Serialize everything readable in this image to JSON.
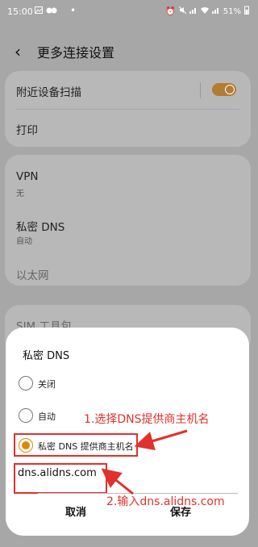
{
  "status_bar": {
    "time": "15:00",
    "battery": "51%",
    "left_icons": [
      "image-icon",
      "bluetooth-icon",
      "dot-icon"
    ],
    "right_icons": [
      "alarm-icon",
      "mute-icon",
      "signal-icon",
      "wifi-icon",
      "signal-icon"
    ]
  },
  "header": {
    "back_icon": "‹",
    "title": "更多连接设置"
  },
  "settings": {
    "nearby_scan": {
      "label": "附近设备扫描",
      "toggle_on": true
    },
    "print": {
      "label": "打印"
    },
    "vpn": {
      "label": "VPN",
      "value": "无"
    },
    "private_dns": {
      "label": "私密 DNS",
      "value": "自动"
    },
    "ethernet": {
      "label": "以太网"
    },
    "sim_toolkit": {
      "label": "SIM 工具包"
    }
  },
  "dialog": {
    "title": "私密 DNS",
    "options": [
      {
        "label": "关闭",
        "selected": false
      },
      {
        "label": "自动",
        "selected": false
      },
      {
        "label": "私密 DNS 提供商主机名",
        "selected": true
      }
    ],
    "hostname_value": "dns.alidns.com",
    "cancel_label": "取消",
    "save_label": "保存"
  },
  "annotations": {
    "step1": "1.选择DNS提供商主机名",
    "step2": "2.输入dns.alidns.com"
  },
  "colors": {
    "accent": "#e08700",
    "annotation": "#e0312d",
    "toggle": "#b27c33"
  }
}
